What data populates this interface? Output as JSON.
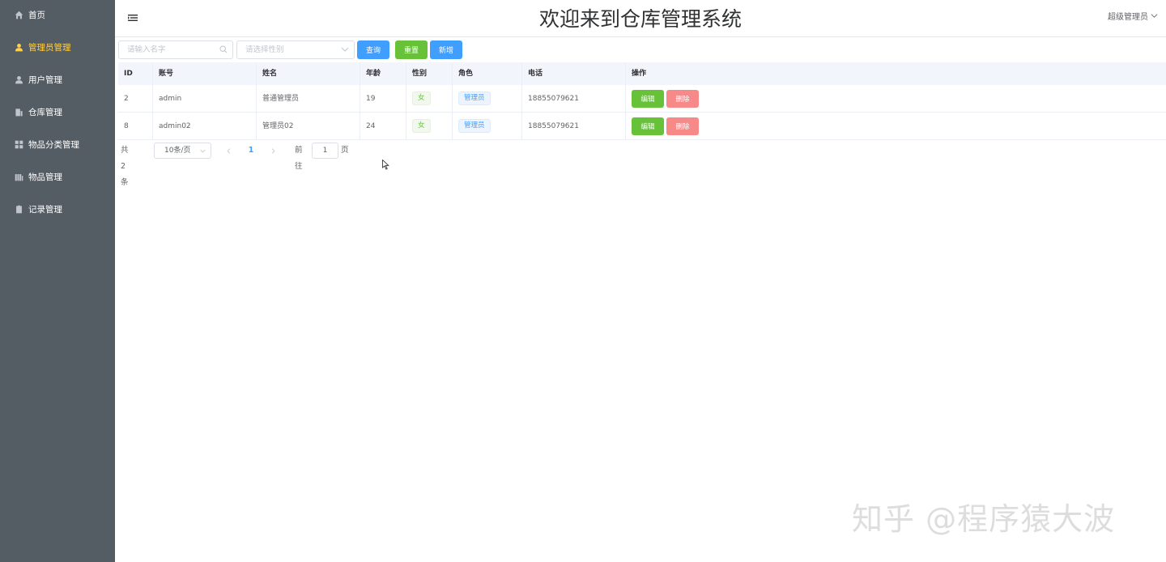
{
  "sidebar": {
    "items": [
      {
        "label": "首页",
        "icon": "home-icon"
      },
      {
        "label": "管理员管理",
        "icon": "user-icon",
        "active": true
      },
      {
        "label": "用户管理",
        "icon": "user-icon"
      },
      {
        "label": "仓库管理",
        "icon": "office-building-icon"
      },
      {
        "label": "物品分类管理",
        "icon": "grid-icon"
      },
      {
        "label": "物品管理",
        "icon": "goods-icon"
      },
      {
        "label": "记录管理",
        "icon": "document-icon"
      }
    ],
    "colors": {
      "background": "#545c64",
      "text": "#ffffff",
      "active": "#ffd04b"
    }
  },
  "header": {
    "title": "欢迎来到仓库管理系统",
    "user": "超级管理员"
  },
  "search": {
    "name_placeholder": "请输入名字",
    "name_value": "",
    "sex_placeholder": "请选择性别",
    "query_label": "查询",
    "reset_label": "重置",
    "add_label": "新增"
  },
  "table": {
    "columns": [
      "ID",
      "账号",
      "姓名",
      "年龄",
      "性别",
      "角色",
      "电话",
      "操作"
    ],
    "rows": [
      {
        "id": "2",
        "account": "admin",
        "name": "普通管理员",
        "age": "19",
        "sex": "女",
        "role": "管理员",
        "phone": "18855079621"
      },
      {
        "id": "8",
        "account": "admin02",
        "name": "管理员02",
        "age": "24",
        "sex": "女",
        "role": "管理员",
        "phone": "18855079621"
      }
    ],
    "edit_label": "编辑",
    "delete_label": "删除"
  },
  "pagination": {
    "total": "共 2 条",
    "page_size": "10条/页",
    "current_page": "1",
    "goto_label": "前往",
    "goto_value": "1",
    "page_suffix": "页"
  },
  "watermark": "知乎 @程序猿大波",
  "colors": {
    "primary": "#409eff",
    "success": "#67c23a",
    "danger": "#f78989"
  }
}
